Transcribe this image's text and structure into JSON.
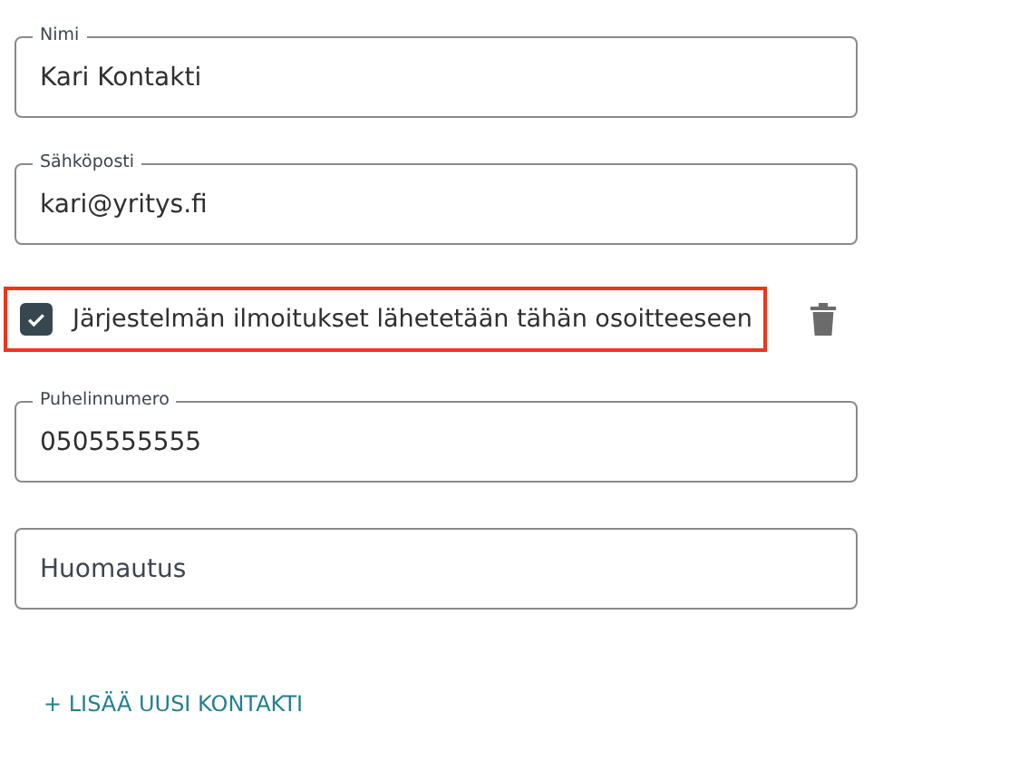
{
  "fields": [
    {
      "label": "Nimi",
      "value": "Kari Kontakti"
    },
    {
      "label": "Sähköposti",
      "value": "kari@yritys.fi"
    },
    {
      "kind": "checkbox",
      "label": "Järjestelmän ilmoitukset lähetetään tähän osoitteeseen",
      "checked": true,
      "highlighted": true
    },
    {
      "label": "Puhelinnumero",
      "value": "0505555555"
    },
    {
      "placeholder": "Huomautus"
    }
  ],
  "add_link": "+ LISÄÄ UUSI KONTAKTI"
}
